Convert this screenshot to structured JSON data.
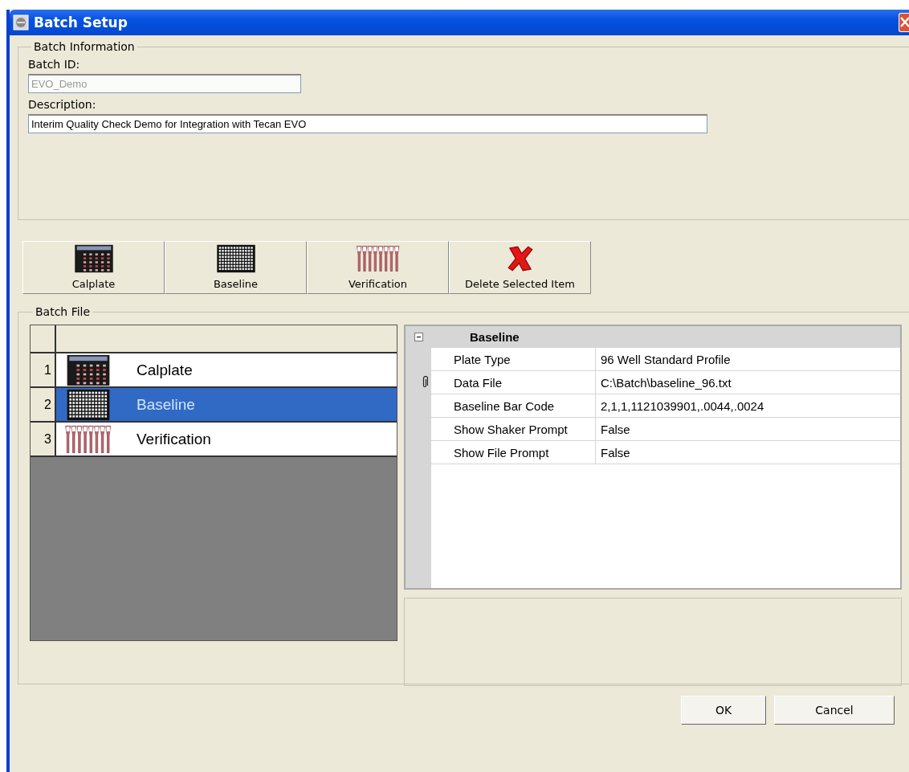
{
  "window": {
    "title": "Batch Setup"
  },
  "batch_information": {
    "title": "Batch Information",
    "batch_id": {
      "label": "Batch ID:",
      "value": "EVO_Demo",
      "disabled": true
    },
    "description": {
      "label": "Description:",
      "value": "Interim Quality Check Demo for Integration with Tecan EVO",
      "disabled": false
    }
  },
  "toolbar": [
    {
      "label": "Calplate",
      "kind": "calplate"
    },
    {
      "label": "Baseline",
      "kind": "baseline"
    },
    {
      "label": "Verification",
      "kind": "verification"
    },
    {
      "label": "Delete Selected Item",
      "kind": "delete"
    }
  ],
  "batch_file": {
    "title": "Batch File",
    "items": [
      {
        "index": "1",
        "label": "Calplate",
        "kind": "calplate",
        "selected": false
      },
      {
        "index": "2",
        "label": "Baseline",
        "kind": "baseline",
        "selected": true
      },
      {
        "index": "3",
        "label": "Verification",
        "kind": "verification",
        "selected": false
      }
    ],
    "properties": {
      "category": "Baseline",
      "expanded": true,
      "rows": [
        {
          "name": "Plate Type",
          "value": "96 Well Standard Profile",
          "kind": "text"
        },
        {
          "name": "Data File",
          "value": "C:\\Batch\\baseline_96.txt",
          "kind": "file"
        },
        {
          "name": "Baseline Bar Code",
          "value": "2,1,1,1121039901,.0044,.0024",
          "kind": "text"
        },
        {
          "name": "Show Shaker Prompt",
          "value": "False",
          "kind": "text"
        },
        {
          "name": "Show File Prompt",
          "value": "False",
          "kind": "text"
        }
      ]
    }
  },
  "buttons": [
    "OK",
    "Cancel"
  ]
}
